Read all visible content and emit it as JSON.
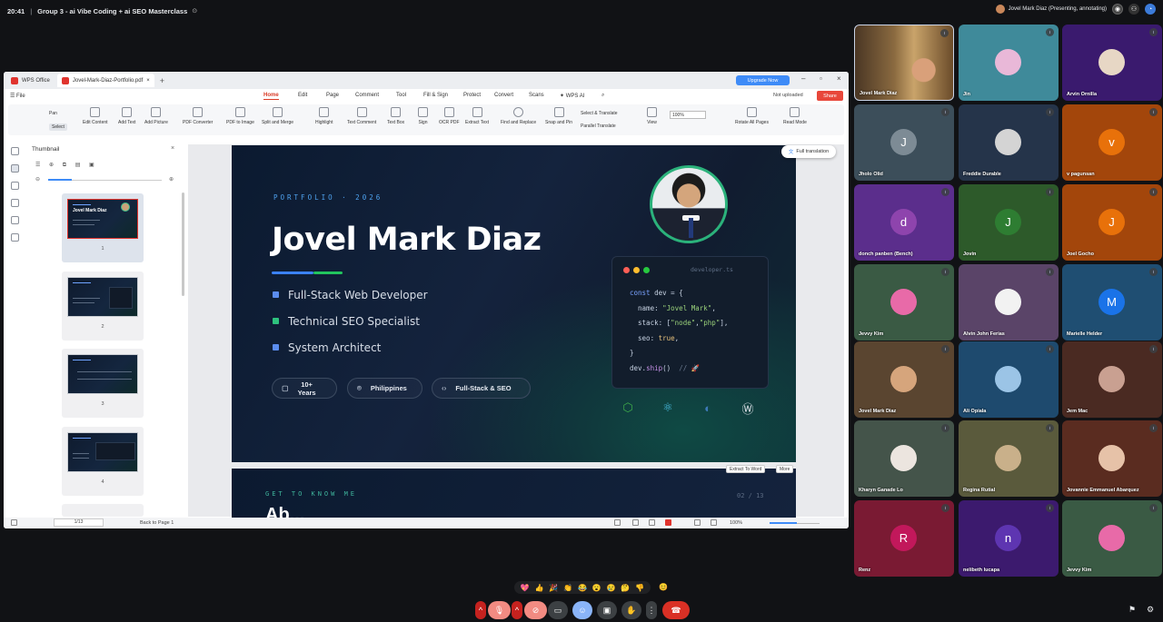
{
  "meet": {
    "time": "20:41",
    "meeting_title": "Group 3 - ai Vibe Coding + ai SEO Masterclass",
    "presenter_label": "Jovel Mark Diaz (Presenting, annotating)"
  },
  "wps": {
    "tabs": [
      "WPS Office",
      "Jovel-Mark-Diaz-Portfolio.pdf"
    ],
    "upgrade_label": "Upgrade Now",
    "file_menu": "File",
    "menu": [
      "Home",
      "Edit",
      "Page",
      "Comment",
      "Tool",
      "Fill & Sign",
      "Protect",
      "Convert",
      "Scans",
      "WPS AI"
    ],
    "active_menu": "Home",
    "not_uploaded": "Not uploaded",
    "share_label": "Share",
    "ribbon": {
      "pan": "Pan",
      "select": "Select",
      "edit_content": "Edit Content",
      "add_text": "Add Text",
      "add_picture": "Add Picture",
      "pdf_converter": "PDF Converter",
      "pdf_to_image": "PDF to Image",
      "split_merge": "Split and Merge",
      "highlight": "Highlight",
      "text_comment": "Text Comment",
      "text_box": "Text Box",
      "sign": "Sign",
      "ocr_pdf": "OCR PDF",
      "extract_text": "Extract Text",
      "find_replace": "Find and Replace",
      "snap_pin": "Snap and Pin",
      "select_translate": "Select & Translate",
      "parallel_translate": "Parallel Translate",
      "view": "View",
      "zoom": "100%",
      "rotate_all": "Rotate All Pages",
      "read_mode": "Read Mode"
    },
    "thumbnail_title": "Thumbnail",
    "thumbs": [
      {
        "num": "1",
        "title": "Jovel Mark Diaz"
      },
      {
        "num": "2",
        "title": ""
      },
      {
        "num": "3",
        "title": ""
      },
      {
        "num": "4",
        "title": ""
      }
    ],
    "full_translation": "Full translation",
    "extract_to_word": "Extract To Word",
    "more": "More",
    "status": {
      "page": "1/13",
      "back": "Back to Page 1",
      "zoom": "100%"
    }
  },
  "slide1": {
    "kicker": "PORTFOLIO · 2026",
    "name": "Jovel Mark Diaz",
    "accent_colors": [
      "#3b82f6",
      "#22c55e"
    ],
    "roles": [
      {
        "label": "Full-Stack Web Developer",
        "color": "#3b82f6"
      },
      {
        "label": "Technical SEO Specialist",
        "color": "#22c55e"
      },
      {
        "label": "System Architect",
        "color": "#3b82f6"
      }
    ],
    "pills": [
      {
        "icon": "briefcase-icon",
        "glyph": "▢",
        "line1": "10+",
        "line2": "Years"
      },
      {
        "icon": "location-icon",
        "glyph": "⌾",
        "line1": "Philippines",
        "line2": ""
      },
      {
        "icon": "code-icon",
        "glyph": "‹›",
        "line1": "Full-Stack & SEO",
        "line2": ""
      }
    ],
    "code_file": "developer.ts",
    "code": {
      "l1a": "const",
      "l1b": " dev = {",
      "l2a": "  name: ",
      "l2b": "\"Jovel Mark\"",
      "l2c": ",",
      "l3a": "  stack: [",
      "l3b": "\"node\"",
      "l3c": ",",
      "l3d": "\"php\"",
      "l3e": "],",
      "l4a": "  seo: ",
      "l4b": "true",
      "l4c": ",",
      "l5": "}",
      "l6a": "dev.",
      "l6b": "ship",
      "l6c": "()  ",
      "l6d": "// 🚀"
    },
    "tech_icons": [
      "nodejs-icon",
      "react-icon",
      "python-icon",
      "wordpress-icon"
    ],
    "tech_glyphs": [
      "⬡",
      "⚛",
      "◐",
      "Ⓦ"
    ],
    "tech_colors": [
      "#3fae4a",
      "#4cc3ea",
      "#3d7ab8",
      "#dfe3ea"
    ]
  },
  "slide2": {
    "kicker": "GET TO KNOW ME",
    "page": "02 / 13",
    "heading": "Ab..."
  },
  "participants": [
    {
      "name": "Jovel Mark Diaz",
      "type": "video",
      "bg": "#6b5a3a"
    },
    {
      "name": "Jin",
      "type": "img",
      "bg": "#3f8a9a",
      "color": "#e9b8d8"
    },
    {
      "name": "Arvin Ornilla",
      "type": "img",
      "bg": "#3a1a6e",
      "color": "#e7d7c5"
    },
    {
      "name": "Jholo Olid",
      "type": "letter",
      "letter": "J",
      "bg": "#3c4e5a",
      "color": "#7d8b95"
    },
    {
      "name": "Freddie Durable",
      "type": "img",
      "bg": "#25344a",
      "color": "#d4d4d4"
    },
    {
      "name": "v pagunsan",
      "type": "letter",
      "letter": "v",
      "bg": "#a3460b",
      "color": "#e8710a"
    },
    {
      "name": "donch panben (Bench)",
      "type": "letter",
      "letter": "d",
      "bg": "#5b2e8c",
      "color": "#8e44ad"
    },
    {
      "name": "Jovin",
      "type": "letter",
      "letter": "J",
      "bg": "#2d5a2a",
      "color": "#2e7d32"
    },
    {
      "name": "Joel Gocho",
      "type": "letter",
      "letter": "J",
      "bg": "#a3460b",
      "color": "#e8710a"
    },
    {
      "name": "Jevvy Kim",
      "type": "img",
      "bg": "#3a5a44",
      "color": "#e86aa8"
    },
    {
      "name": "Alvin John Ferias",
      "type": "img",
      "bg": "#5a4468",
      "color": "#f2f2f2"
    },
    {
      "name": "Marielle Helder",
      "type": "letter",
      "letter": "M",
      "bg": "#1f4e72",
      "color": "#1a73e8"
    },
    {
      "name": "Jovel Mark Diaz",
      "type": "img",
      "bg": "#5a4530",
      "color": "#d6a57c"
    },
    {
      "name": "Ali Opiala",
      "type": "img",
      "bg": "#1e4a6e",
      "color": "#9bc4e6"
    },
    {
      "name": "Jem Mac",
      "type": "img",
      "bg": "#4a2a22",
      "color": "#c9a091"
    },
    {
      "name": "Kharyn Ganade Lo",
      "type": "img",
      "bg": "#44544a",
      "color": "#ece5df"
    },
    {
      "name": "Regina Rutial",
      "type": "img",
      "bg": "#5a5a3c",
      "color": "#c9b08a"
    },
    {
      "name": "Jovannie Emmanuel Abarquez",
      "type": "img",
      "bg": "#5a2c20",
      "color": "#e6c2a8"
    },
    {
      "name": "Renz",
      "type": "letter",
      "letter": "R",
      "bg": "#7a1a33",
      "color": "#c2185b"
    },
    {
      "name": "nelibeth lucapa",
      "type": "letter",
      "letter": "n",
      "bg": "#3c1a6e",
      "color": "#5e35b1"
    },
    {
      "name": "Jevvy Kim",
      "type": "img",
      "bg": "#3a5a44",
      "color": "#e86aa8"
    }
  ],
  "reactions": [
    "💖",
    "👍",
    "🎉",
    "👏",
    "😂",
    "😮",
    "😢",
    "🤔",
    "👎"
  ],
  "reaction_extra": "😊",
  "controls": [
    {
      "name": "mic-options-icon",
      "glyph": "^",
      "bg": "#c5221f"
    },
    {
      "name": "mic-off-icon",
      "glyph": "🎙",
      "bg": "#f28b82"
    },
    {
      "name": "camera-options-icon",
      "glyph": "^",
      "bg": "#c5221f"
    },
    {
      "name": "camera-off-icon",
      "glyph": "⊘",
      "bg": "#f28b82"
    },
    {
      "name": "captions-icon",
      "glyph": "▭",
      "bg": "#3c4043"
    },
    {
      "name": "emoji-icon",
      "glyph": "☺",
      "bg": "#8ab4f8"
    },
    {
      "name": "present-icon",
      "glyph": "▣",
      "bg": "#3c4043"
    },
    {
      "name": "raise-hand-icon",
      "glyph": "✋",
      "bg": "#3c4043"
    },
    {
      "name": "more-options-icon",
      "glyph": "⋮",
      "bg": "#3c4043"
    },
    {
      "name": "end-call-icon",
      "glyph": "☎",
      "bg": "#d93025"
    }
  ]
}
